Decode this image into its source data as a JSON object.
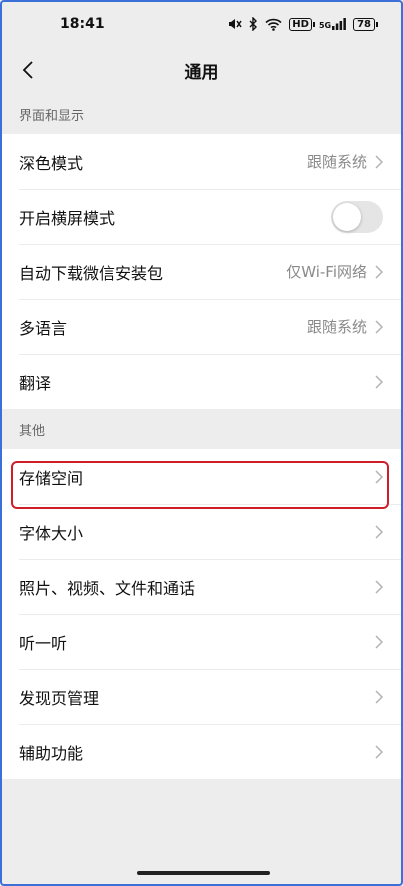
{
  "status_bar": {
    "time": "18:41",
    "battery": "78",
    "signal_label": "5G",
    "hd_label": "HD"
  },
  "nav": {
    "title": "通用"
  },
  "sections": [
    {
      "header": "界面和显示",
      "items": [
        {
          "label": "深色模式",
          "value": "跟随系统",
          "type": "link"
        },
        {
          "label": "开启横屏模式",
          "value": "",
          "type": "toggle",
          "on": false
        },
        {
          "label": "自动下载微信安装包",
          "value": "仅Wi-Fi网络",
          "type": "link"
        },
        {
          "label": "多语言",
          "value": "跟随系统",
          "type": "link"
        },
        {
          "label": "翻译",
          "value": "",
          "type": "link"
        }
      ]
    },
    {
      "header": "其他",
      "items": [
        {
          "label": "存储空间",
          "value": "",
          "type": "link",
          "highlighted": true
        },
        {
          "label": "字体大小",
          "value": "",
          "type": "link"
        },
        {
          "label": "照片、视频、文件和通话",
          "value": "",
          "type": "link"
        },
        {
          "label": "听一听",
          "value": "",
          "type": "link"
        },
        {
          "label": "发现页管理",
          "value": "",
          "type": "link"
        },
        {
          "label": "辅助功能",
          "value": "",
          "type": "link"
        }
      ]
    }
  ],
  "colors": {
    "accent_highlight": "#d01d2a",
    "frame": "#3d6fd9",
    "background": "#ededed"
  }
}
